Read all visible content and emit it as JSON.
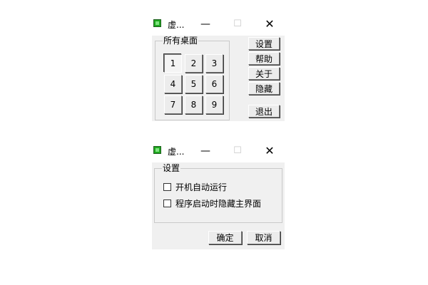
{
  "window1": {
    "title": "虚...",
    "group_label": "所有桌面",
    "desktops": [
      "1",
      "2",
      "3",
      "4",
      "5",
      "6",
      "7",
      "8",
      "9"
    ],
    "selected_desktop": "1",
    "buttons": {
      "settings": "设置",
      "help": "帮助",
      "about": "关于",
      "hide": "隐藏",
      "exit": "退出"
    }
  },
  "window2": {
    "title": "虚...",
    "group_label": "设置",
    "options": [
      {
        "label": "开机自动运行",
        "checked": false
      },
      {
        "label": "程序启动时隐藏主界面",
        "checked": false
      }
    ],
    "buttons": {
      "ok": "确定",
      "cancel": "取消"
    }
  },
  "controls": {
    "minimize": "—",
    "maximize": "☐",
    "close": "✕"
  },
  "colors": {
    "window_bg": "#f0f0f0",
    "titlebar_bg": "#ffffff",
    "app_icon": "#1fa81f"
  }
}
